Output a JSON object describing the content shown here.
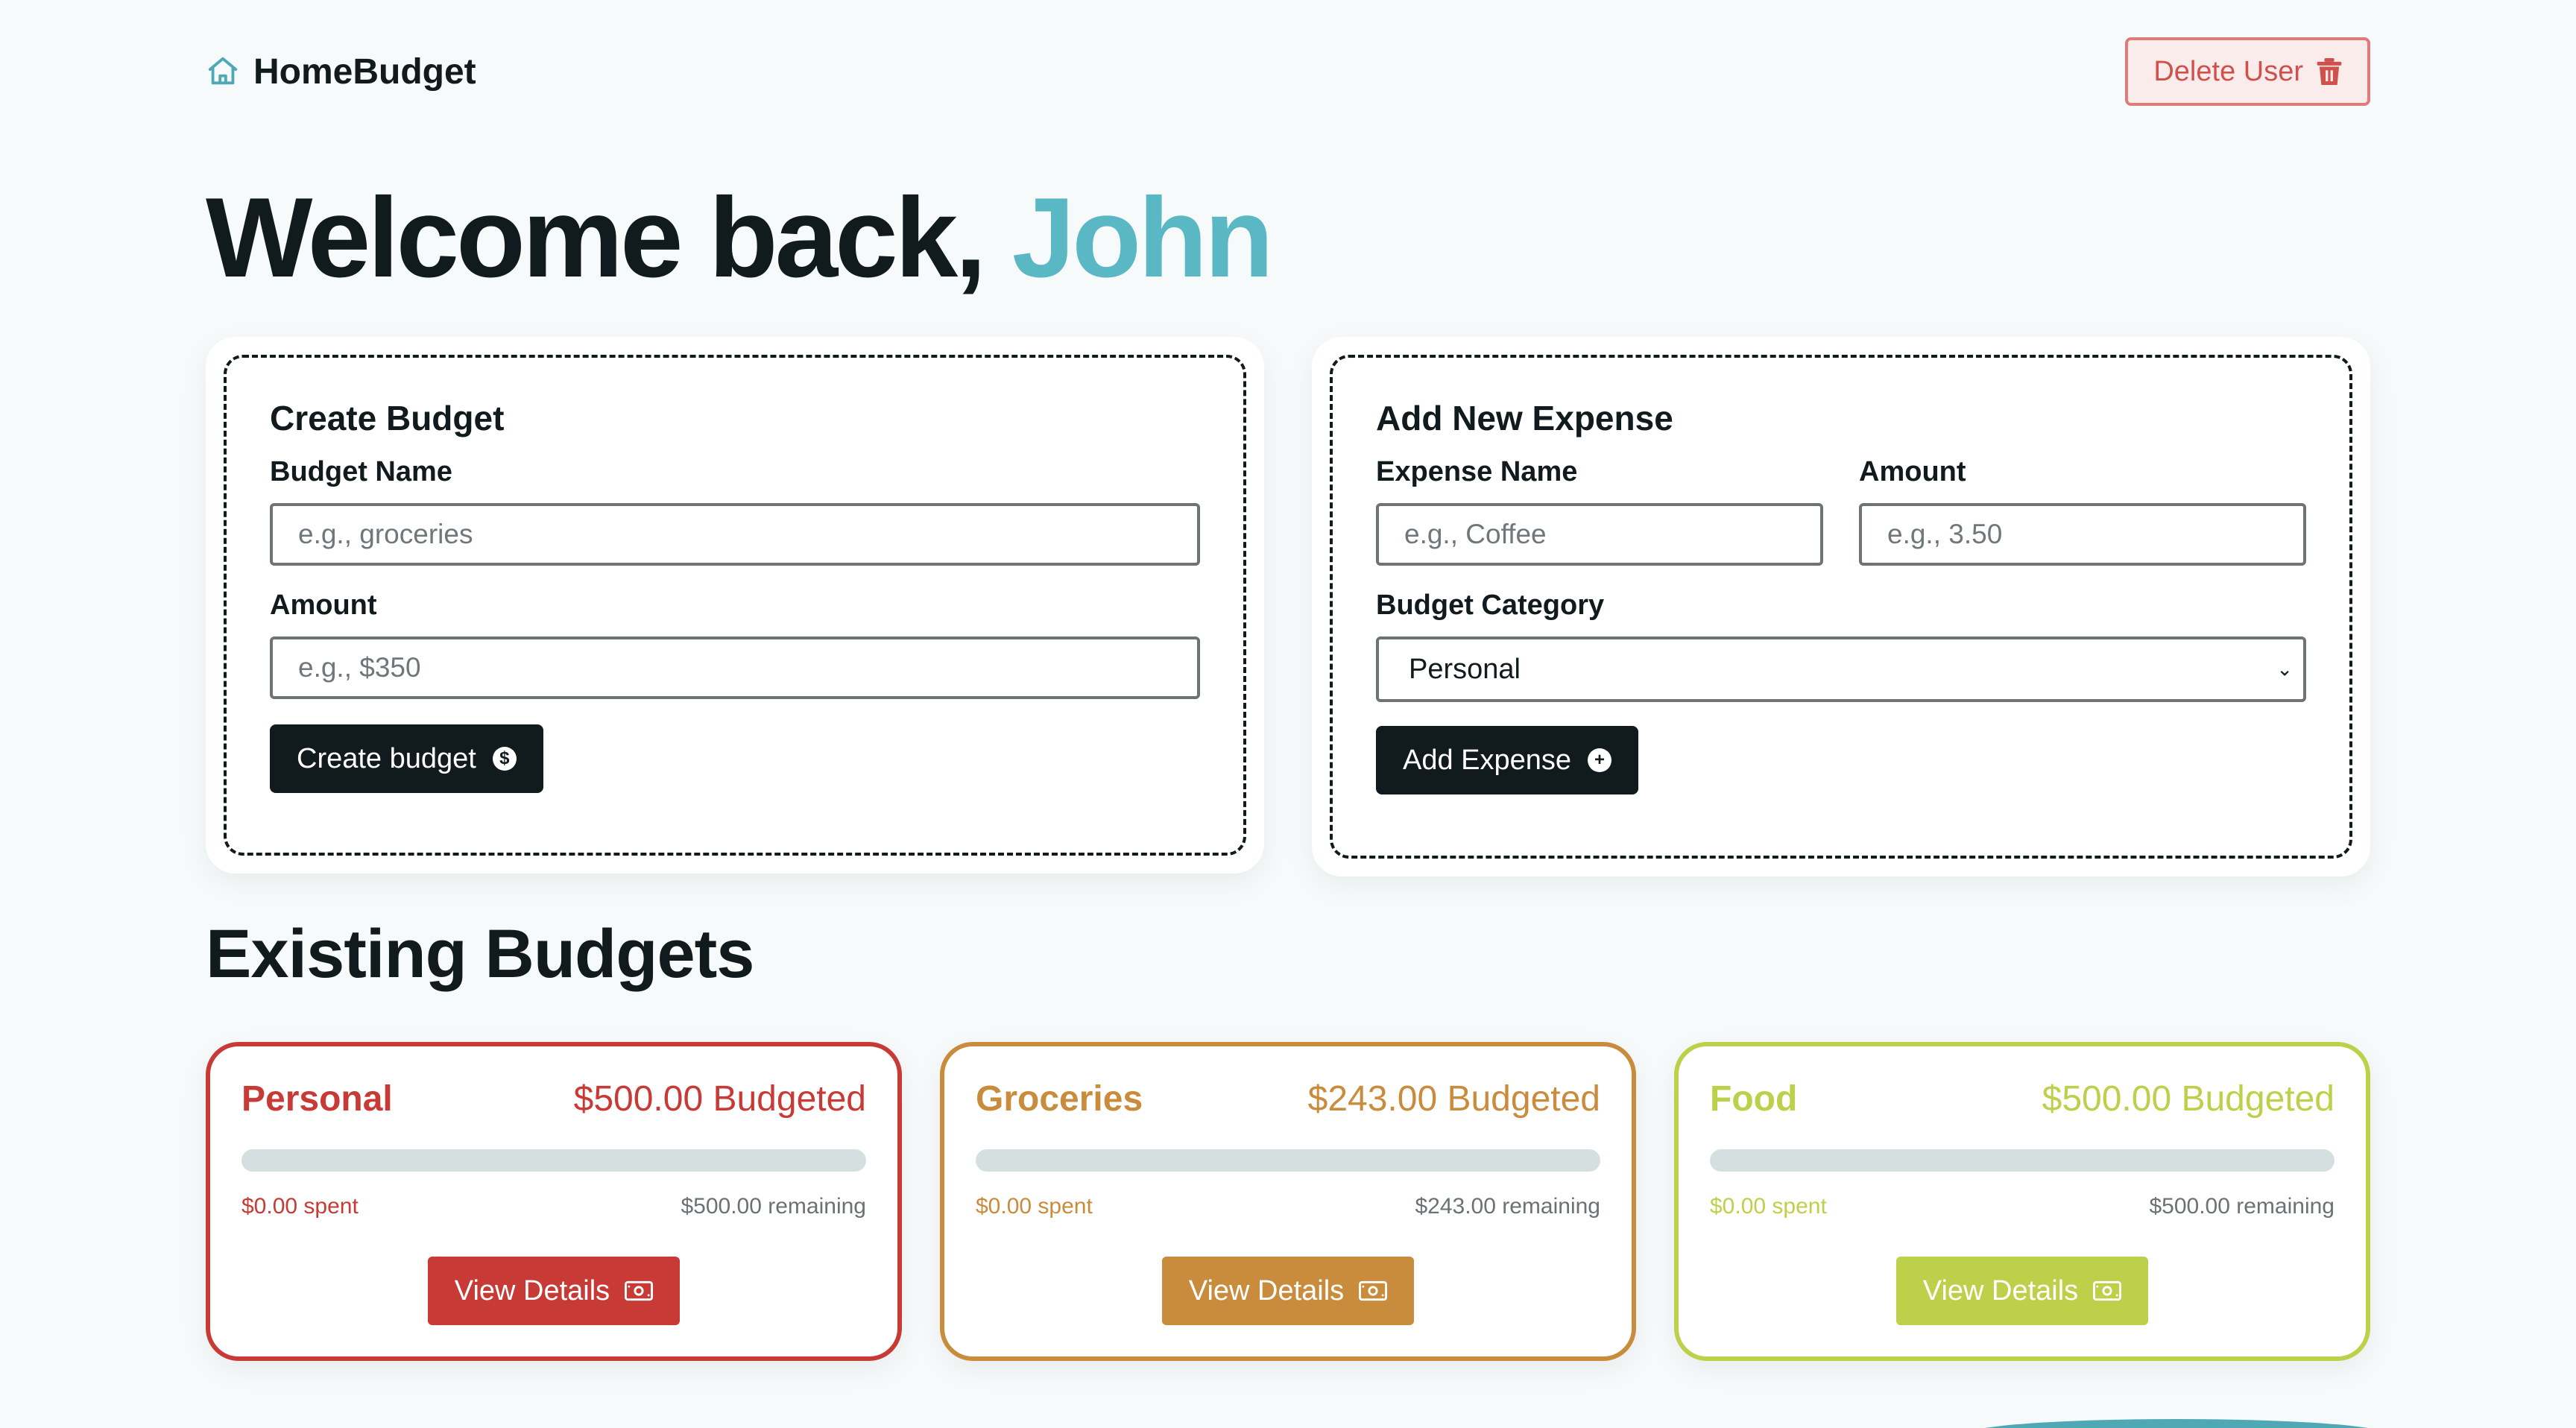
{
  "header": {
    "brand": "HomeBudget",
    "brand_icon": "home-icon",
    "delete_label": "Delete User",
    "delete_icon": "trash-icon"
  },
  "welcome": {
    "prefix": "Welcome back,",
    "name": "John",
    "name_color": "#5ab8c4"
  },
  "create_budget": {
    "title": "Create Budget",
    "name_label": "Budget Name",
    "name_placeholder": "e.g., groceries",
    "name_value": "",
    "amount_label": "Amount",
    "amount_placeholder": "e.g., $350",
    "amount_value": "",
    "button_label": "Create budget",
    "button_icon": "dollar-circle-icon"
  },
  "add_expense": {
    "title": "Add New Expense",
    "name_label": "Expense Name",
    "name_placeholder": "e.g., Coffee",
    "name_value": "",
    "amount_label": "Amount",
    "amount_placeholder": "e.g., 3.50",
    "amount_value": "",
    "category_label": "Budget Category",
    "category_selected": "Personal",
    "button_label": "Add Expense",
    "button_icon": "plus-circle-icon"
  },
  "existing": {
    "title": "Existing Budgets",
    "budgets": [
      {
        "name": "Personal",
        "budgeted": "$500.00 Budgeted",
        "spent": "$0.00 spent",
        "remaining": "$500.00 remaining",
        "progress": 0,
        "color": "#c73a35",
        "button_label": "View Details",
        "button_icon": "banknote-icon"
      },
      {
        "name": "Groceries",
        "budgeted": "$243.00 Budgeted",
        "spent": "$0.00 spent",
        "remaining": "$243.00 remaining",
        "progress": 0,
        "color": "#c98c3c",
        "button_label": "View Details",
        "button_icon": "banknote-icon"
      },
      {
        "name": "Food",
        "budgeted": "$500.00 Budgeted",
        "spent": "$0.00 spent",
        "remaining": "$500.00 remaining",
        "progress": 0,
        "color": "#bdd04a",
        "button_label": "View Details",
        "button_icon": "banknote-icon"
      }
    ]
  },
  "colors": {
    "background": "#f7fafb",
    "dark": "#111a1c",
    "accent": "#5ab8c4",
    "danger": "#d0504c"
  }
}
